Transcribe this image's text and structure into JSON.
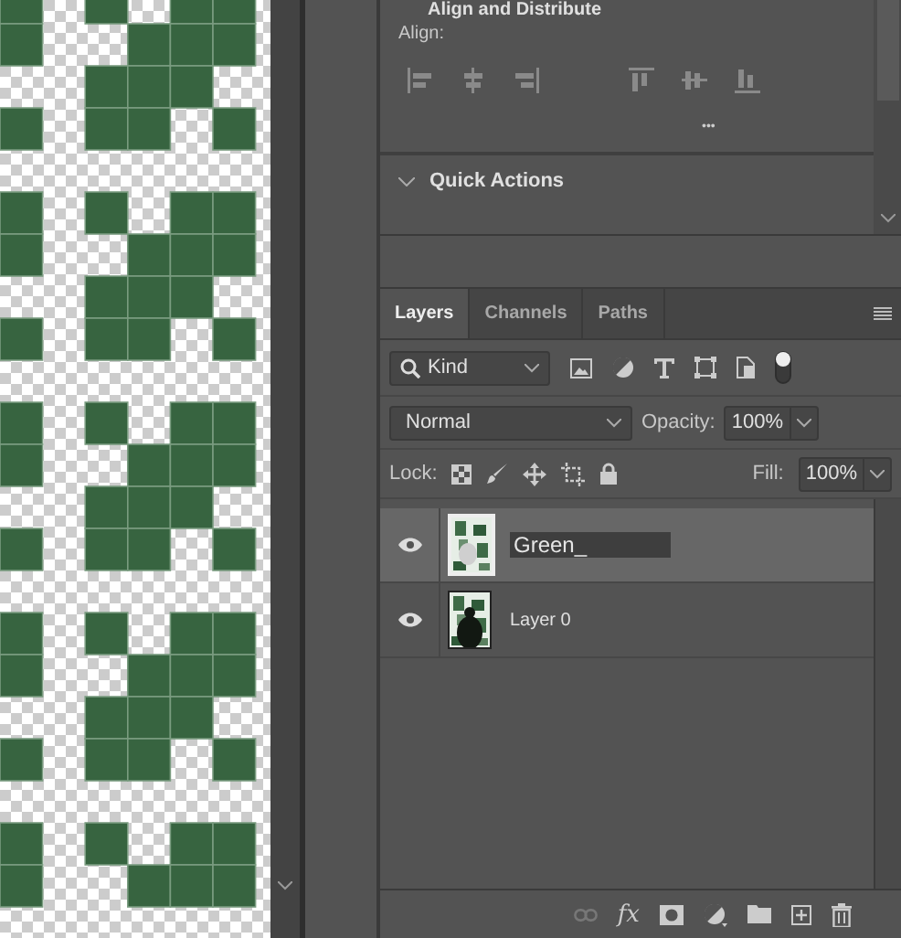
{
  "properties": {
    "section_title": "Align and Distribute",
    "align_label": "Align:",
    "more": "•••",
    "quick_actions_title": "Quick Actions"
  },
  "tabs": [
    {
      "label": "Layers",
      "selected": true
    },
    {
      "label": "Channels",
      "selected": false
    },
    {
      "label": "Paths",
      "selected": false
    }
  ],
  "filter": {
    "value": "Kind",
    "on": true
  },
  "blend_mode": "Normal",
  "opacity_label": "Opacity:",
  "opacity": "100%",
  "lock_label": "Lock:",
  "fill_label": "Fill:",
  "fill": "100%",
  "layers": [
    {
      "name": "Green_",
      "visible": true,
      "selected": true,
      "editing": true
    },
    {
      "name": "Layer 0",
      "visible": true,
      "selected": false,
      "editing": false
    }
  ],
  "footer": {
    "fx": "fx"
  }
}
